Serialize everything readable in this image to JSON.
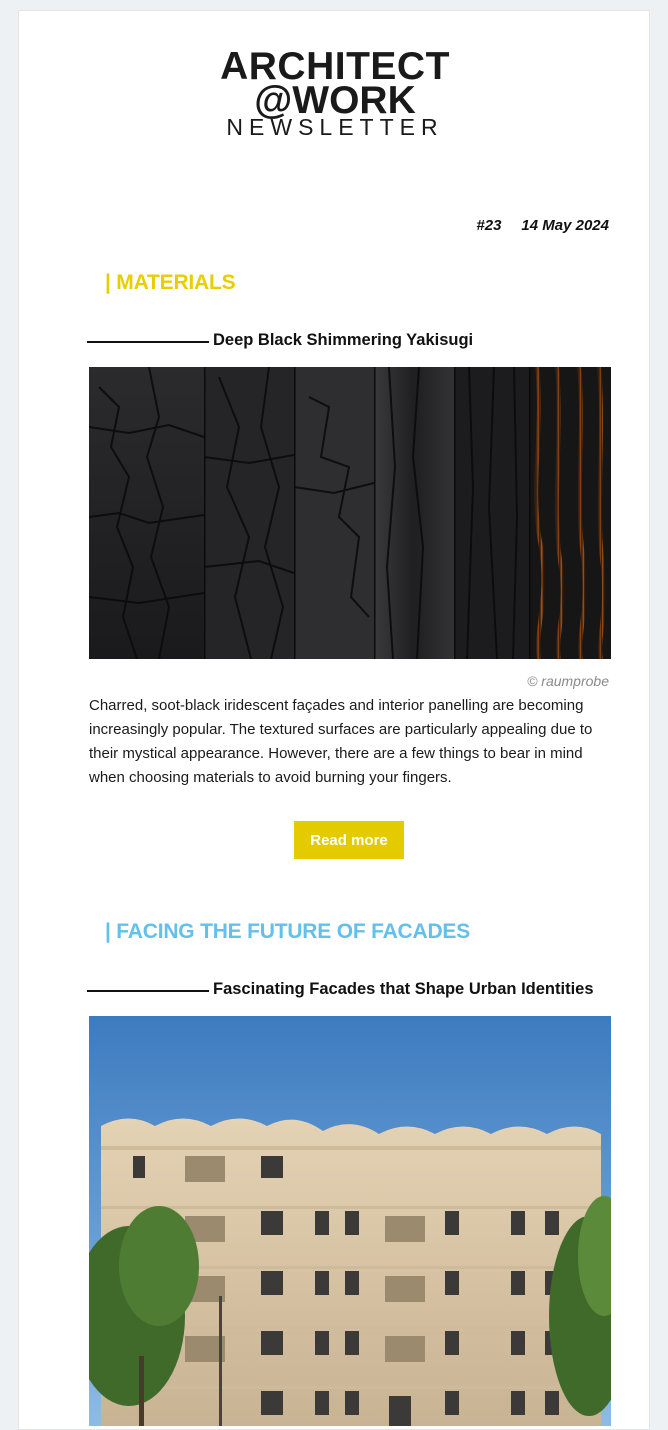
{
  "header": {
    "logo_line1": "ARCHITECT",
    "logo_line2": "@WORK",
    "logo_line3": "NEWSLETTER"
  },
  "issue": {
    "number": "#23",
    "date": "14 May 2024"
  },
  "sections": [
    {
      "heading": "| MATERIALS",
      "color": "#e8ce00",
      "article": {
        "title": "Deep Black Shimmering Yakisugi",
        "credit": "© raumprobe",
        "body": "Charred, soot-black iridescent façades and interior panelling are becoming increasingly popular. The textured surfaces are particularly appealing due to their mystical appearance. However, there are a few things to bear in mind when choosing materials to avoid burning your fingers.",
        "button_label": "Read more",
        "button_color": "#e4cb00"
      }
    },
    {
      "heading": "| FACING THE FUTURE OF FACADES",
      "color": "#63c0ec",
      "article": {
        "title": "Fascinating Facades that Shape Urban Identities"
      }
    }
  ]
}
